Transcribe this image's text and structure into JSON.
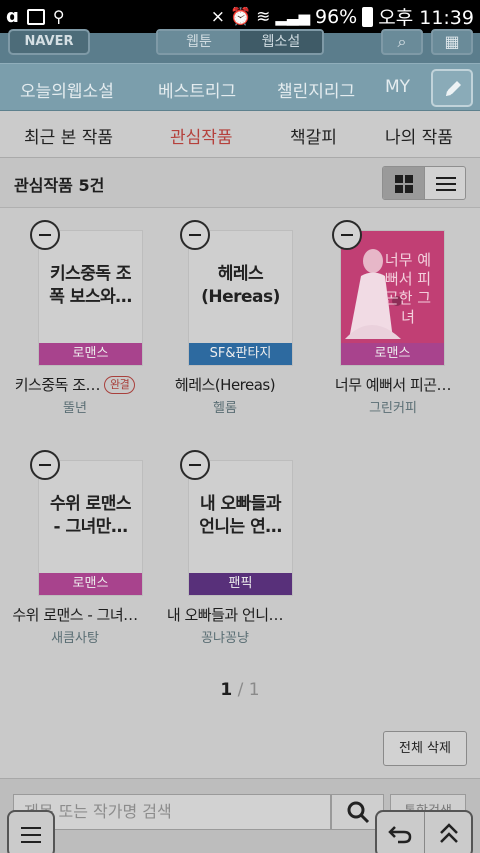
{
  "status_bar": {
    "battery": "96%",
    "time": "오후 11:39"
  },
  "app_header": {
    "logo": "NAVER",
    "segments": [
      "웹툰",
      "웹소설"
    ],
    "active_segment": "웹소설"
  },
  "category_nav": {
    "items": [
      "오늘의웹소설",
      "베스트리그",
      "챌린지리그",
      "MY"
    ]
  },
  "sub_tabs": {
    "items": [
      "최근 본 작품",
      "관심작품",
      "책갈피",
      "나의 작품"
    ],
    "active": "관심작품",
    "active_color": "#b5413c"
  },
  "list": {
    "title": "관심작품 5건"
  },
  "books": [
    {
      "cover_text": "키스중독 조폭 보스와…",
      "genre": "로맨스",
      "title": "키스중독 조…",
      "badge": "완결",
      "author": "뚤년"
    },
    {
      "cover_text": "헤레스(Hereas)",
      "genre": "SF&판타지",
      "title": "헤레스(Hereas)",
      "badge": "",
      "author": "헬롬"
    },
    {
      "cover_text": "너무 예뻐서 피곤한 그녀",
      "genre": "로맨스",
      "title": "너무 예뻐서 피곤…",
      "badge": "",
      "author": "그린커피"
    },
    {
      "cover_text": "수위 로맨스 - 그녀만…",
      "genre": "로맨스",
      "title": "수위 로맨스 - 그녀…",
      "badge": "",
      "author": "새큼사탕"
    },
    {
      "cover_text": "내 오빠들과 언니는 연…",
      "genre": "팬픽",
      "title": "내 오빠들과 언니…",
      "badge": "",
      "author": "꽁냐꽁냥"
    }
  ],
  "pagination": {
    "current": "1",
    "separator": " / ",
    "total": "1"
  },
  "delete_all": "전체 삭제",
  "search": {
    "placeholder": "제목 또는 작가명 검색",
    "unified_label": "통합검색"
  }
}
